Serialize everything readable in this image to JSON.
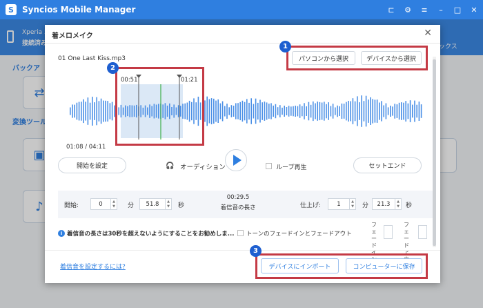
{
  "app": {
    "title": "Syncios Mobile Manager",
    "logo_letter": "S",
    "controls": [
      "⊏",
      "⚙",
      "≡",
      "–",
      "□",
      "✕"
    ]
  },
  "background": {
    "device_name": "Xperia 5",
    "device_status": "接続済み",
    "toolbox_label": "ックス",
    "section_backup": "バックア",
    "section_convert": "変換ツール"
  },
  "dialog": {
    "title": "着メロメイク",
    "close": "✕",
    "file_name": "01 One Last Kiss.mp3",
    "from_pc": "パソコンから選択",
    "from_device": "デバイスから選択",
    "selection_start": "00:51",
    "selection_end": "01:21",
    "progress": "01:08 / 04:11",
    "set_start": "開始を設定",
    "audition": "オーディション",
    "loop": "ループ再生",
    "set_end": "セットエンド",
    "start_label": "開始:",
    "start_min": "0",
    "min_unit": "分",
    "start_sec": "51.8",
    "sec_unit": "秒",
    "ring_length": "00:29.5",
    "ring_length_label": "着信音の長さ",
    "finish_label": "仕上げ:",
    "end_min": "1",
    "end_sec": "21.3",
    "info_icon": "i",
    "info_text": "着信音の長さは30秒を超えないようにすることをお勧めしま...",
    "fade_label": "トーンのフェードインとフェードアウト",
    "fade_in": "フェードイン",
    "fade_out": "フェードアウト",
    "help_link": "着信音を設定するには?",
    "import_device": "デバイスにインポート",
    "save_computer": "コンピューターに保存"
  },
  "badges": [
    "1",
    "2",
    "3"
  ],
  "colors": {
    "accent": "#2f7fe0",
    "annotation_red": "#c43a45",
    "badge_blue": "#1e5fd0",
    "selection_fill": "#dbe8f6",
    "playhead": "#3db04a"
  }
}
